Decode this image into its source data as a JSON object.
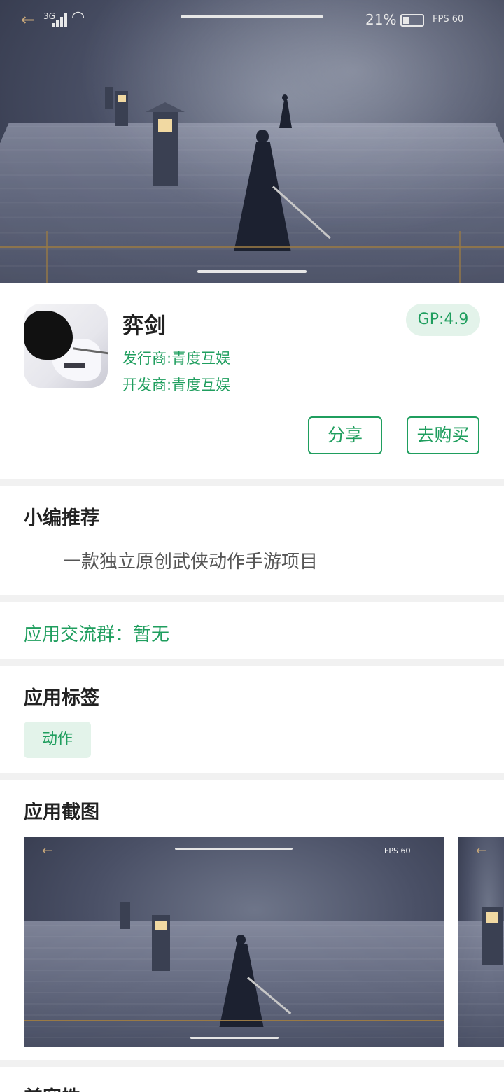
{
  "status_bar": {
    "network": "3G",
    "battery_percent": "21%",
    "fps_label": "FPS 60"
  },
  "hero": {
    "back_icon": "back-arrow-icon"
  },
  "app": {
    "title": "弈剑",
    "publisher": "发行商:青度互娱",
    "developer": "开发商:青度互娱",
    "gp_rating": "GP:4.9",
    "share_button": "分享",
    "buy_button": "去购买"
  },
  "recommendation": {
    "title": "小编推荐",
    "text": "一款独立原创武侠动作手游项目"
  },
  "group": {
    "text": "应用交流群：暂无"
  },
  "tags": {
    "title": "应用标签",
    "items": [
      "动作"
    ]
  },
  "screenshots": {
    "title": "应用截图",
    "fps_label": "FPS 60"
  },
  "next_section": {
    "title": "兼容性"
  },
  "colors": {
    "accent": "#1f9e5e",
    "accent_light": "#e3f3ea",
    "text_primary": "#222222",
    "text_secondary": "#555555",
    "divider_bg": "#f1f1f1"
  }
}
